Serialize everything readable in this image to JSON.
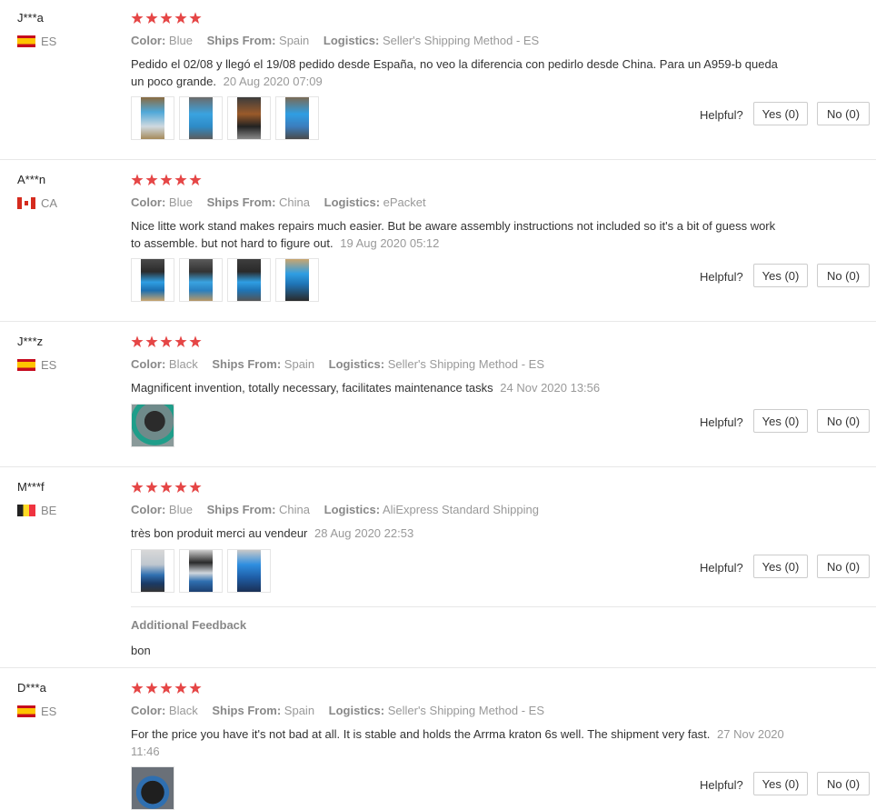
{
  "colors": {
    "star": "#e54646",
    "divider": "#e8e8e8"
  },
  "labels": {
    "color": "Color:",
    "ships_from": "Ships From:",
    "logistics": "Logistics:",
    "helpful": "Helpful?"
  },
  "reviews": [
    {
      "user": "J***a",
      "country": "ES",
      "flag": "spain-flag-icon",
      "stars": 5,
      "color": "Blue",
      "ships_from": "Spain",
      "logistics": "Seller's Shipping Method - ES",
      "text": "Pedido el 02/08 y llegó el 19/08 pedido desde España, no veo la diferencia con pedirlo desde China. Para un A959-b queda un poco grande.",
      "date": "20 Aug 2020 07:09",
      "yes": "Yes (0)",
      "no": "No (0)"
    },
    {
      "user": "A***n",
      "country": "CA",
      "flag": "canada-flag-icon",
      "stars": 5,
      "color": "Blue",
      "ships_from": "China",
      "logistics": "ePacket",
      "text": "Nice litte work stand makes repairs much easier. But be aware assembly instructions not included so it's a bit of guess work to assemble. but not hard to figure out.",
      "date": "19 Aug 2020 05:12",
      "yes": "Yes (0)",
      "no": "No (0)"
    },
    {
      "user": "J***z",
      "country": "ES",
      "flag": "spain-flag-icon",
      "stars": 5,
      "color": "Black",
      "ships_from": "Spain",
      "logistics": "Seller's Shipping Method - ES",
      "text": "Magnificent invention, totally necessary, facilitates maintenance tasks",
      "date": "24 Nov 2020 13:56",
      "yes": "Yes (0)",
      "no": "No (0)"
    },
    {
      "user": "M***f",
      "country": "BE",
      "flag": "belgium-flag-icon",
      "stars": 5,
      "color": "Blue",
      "ships_from": "China",
      "logistics": "AliExpress Standard Shipping",
      "text": "très bon produit merci au vendeur",
      "date": "28 Aug 2020 22:53",
      "yes": "Yes (0)",
      "no": "No (0)",
      "additional_feedback_label": "Additional Feedback",
      "additional_feedback": "bon"
    },
    {
      "user": "D***a",
      "country": "ES",
      "flag": "spain-flag-icon",
      "stars": 5,
      "color": "Black",
      "ships_from": "Spain",
      "logistics": "Seller's Shipping Method - ES",
      "text": "For the price you have it's not bad at all. It is stable and holds the Arrma kraton 6s well. The shipment very fast.",
      "date": "27 Nov 2020 11:46",
      "yes": "Yes (0)",
      "no": "No (0)"
    }
  ]
}
